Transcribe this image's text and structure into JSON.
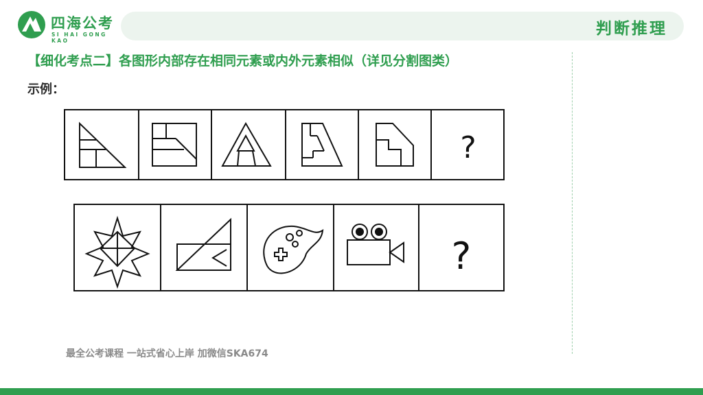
{
  "logo": {
    "cn": "四海公考",
    "en": "SI HAI GONG KAO"
  },
  "header": {
    "section_title": "判断推理"
  },
  "main": {
    "heading": "【细化考点二】各图形内部存在相同元素或内外元素相似（详见分割图类）",
    "example_label": "示例：",
    "puzzle_row_1": {
      "question_mark": "?"
    },
    "puzzle_row_2": {
      "question_mark": "?"
    }
  },
  "footer": {
    "text": "最全公考课程 一站式省心上岸 加微信SKA674"
  },
  "colors": {
    "brand_green": "#2f9e4f",
    "header_bg": "#ecf4ee",
    "footer_text": "#8a8a8a"
  }
}
